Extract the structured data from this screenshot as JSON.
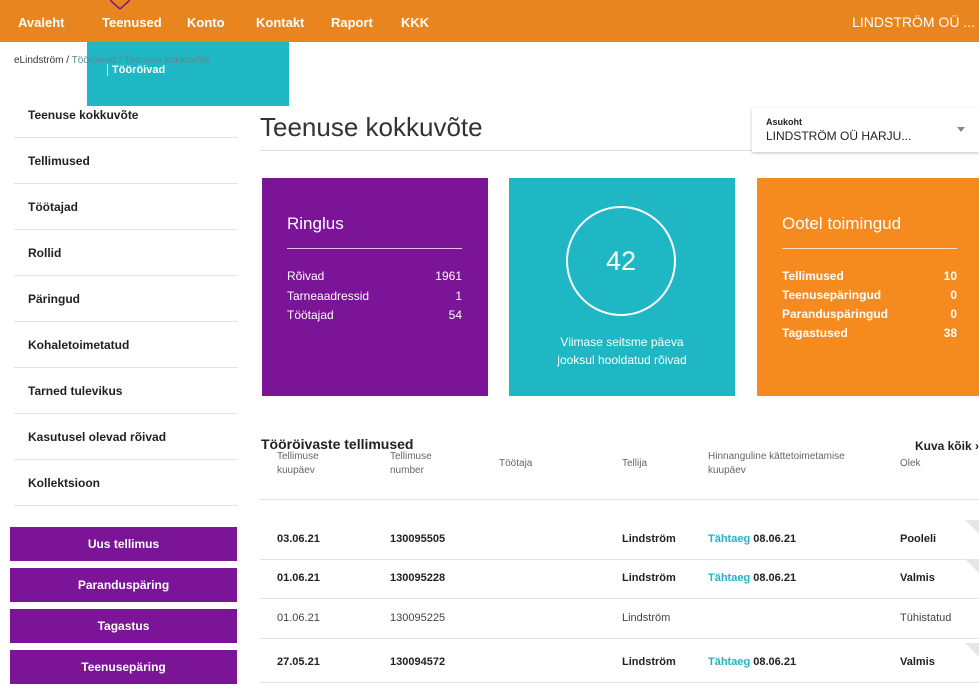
{
  "nav": {
    "items": [
      "Avaleht",
      "Teenused",
      "Konto",
      "Kontakt",
      "Raport",
      "KKK"
    ],
    "company": "LINDSTRÖM OÜ ...",
    "accent": "#e8851e"
  },
  "dropdown": {
    "item": "Tööröivad"
  },
  "breadcrumb": {
    "home": "eLindström",
    "sep1": " / ",
    "mid": "Tööröivad",
    "sep2": " / ",
    "current": "Teenuse kokkuvõte"
  },
  "sidebar": {
    "items": [
      "Teenuse kokkuvõte",
      "Tellimused",
      "Töötajad",
      "Rollid",
      "Päringud",
      "Kohaletoimetatud",
      "Tarned tulevikus",
      "Kasutusel olevad rõivad",
      "Kollektsioon"
    ],
    "actions": [
      "Uus tellimus",
      "Paranduspäring",
      "Tagastus",
      "Teenusepäring"
    ]
  },
  "page": {
    "title": "Teenuse kokkuvõte"
  },
  "location": {
    "label": "Asukoht",
    "value": "LINDSTRÖM OÜ HARJU..."
  },
  "cards": {
    "ringlus": {
      "title": "Ringlus",
      "rows": [
        {
          "label": "Rõivad",
          "value": "1961"
        },
        {
          "label": "Tarneaadressid",
          "value": "1"
        },
        {
          "label": "Töötajad",
          "value": "54"
        }
      ],
      "color": "#7b1497"
    },
    "maintained": {
      "count": "42",
      "caption_line1": "Viimase seitsme päeva",
      "caption_line2": "jooksul hooldatud rõivad",
      "color": "#1fb7c4"
    },
    "pending": {
      "title": "Ootel toimingud",
      "rows": [
        {
          "label": "Tellimused",
          "value": "10"
        },
        {
          "label": "Teenusepäringud",
          "value": "0"
        },
        {
          "label": "Paranduspäringud",
          "value": "0"
        },
        {
          "label": "Tagastused",
          "value": "38"
        }
      ],
      "color": "#f58a1f"
    }
  },
  "orders": {
    "title": "Tööröivaste tellimused",
    "show_all": "Kuva kõik",
    "headers": {
      "date_l1": "Tellimuse",
      "date_l2": "kuupäev",
      "num_l1": "Tellimuse",
      "num_l2": "number",
      "employee": "Töötaja",
      "orderer": "Tellija",
      "eta_l1": "Hinnanguline kättetoimetamise",
      "eta_l2": "kuupäev",
      "status": "Olek"
    },
    "rows": [
      {
        "date": "03.06.21",
        "number": "130095505",
        "employee": "",
        "orderer": "Lindström",
        "due_label": "Tähtaeg",
        "due_date": "08.06.21",
        "status": "Pooleli"
      },
      {
        "date": "01.06.21",
        "number": "130095228",
        "employee": "",
        "orderer": "Lindström",
        "due_label": "Tähtaeg",
        "due_date": "08.06.21",
        "status": "Valmis"
      },
      {
        "date": "01.06.21",
        "number": "130095225",
        "employee": "",
        "orderer": "Lindström",
        "due_label": "",
        "due_date": "",
        "status": "Tühistatud"
      },
      {
        "date": "27.05.21",
        "number": "130094572",
        "employee": "",
        "orderer": "Lindström",
        "due_label": "Tähtaeg",
        "due_date": "08.06.21",
        "status": "Valmis"
      }
    ]
  }
}
